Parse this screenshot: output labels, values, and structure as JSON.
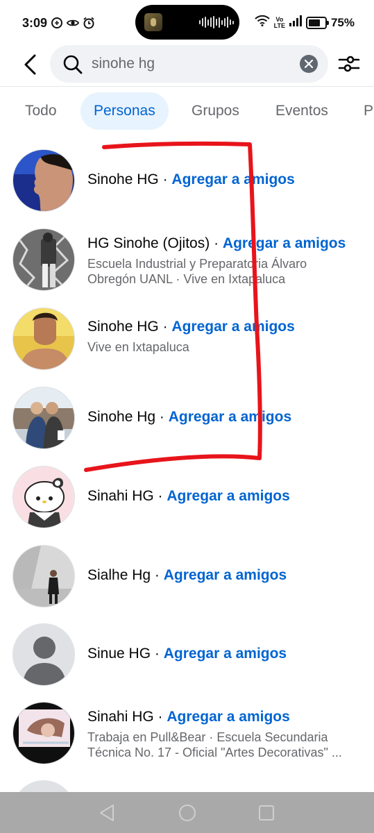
{
  "status_bar": {
    "time": "3:09",
    "volte": "Vo LTE",
    "battery": "75%"
  },
  "search": {
    "query": "sinohe hg"
  },
  "tabs": [
    {
      "label": "Todo",
      "active": false
    },
    {
      "label": "Personas",
      "active": true
    },
    {
      "label": "Grupos",
      "active": false
    },
    {
      "label": "Eventos",
      "active": false
    },
    {
      "label": "P",
      "active": false
    }
  ],
  "results": [
    {
      "name": "Sinohe HG",
      "action": "Agregar a amigos",
      "subtitle": ""
    },
    {
      "name": "HG Sinohe (Ojitos)",
      "action": "Agregar a amigos",
      "subtitle": "Escuela Industrial y Preparatoria Álvaro",
      "subtitle2": "Obregón UANL · Vive en Ixtapaluca"
    },
    {
      "name": "Sinohe HG",
      "action": "Agregar a amigos",
      "subtitle": "Vive en Ixtapaluca"
    },
    {
      "name": "Sinohe Hg",
      "action": "Agregar a amigos",
      "subtitle": ""
    },
    {
      "name": "Sinahi HG",
      "action": "Agregar a amigos",
      "subtitle": ""
    },
    {
      "name": "Sialhe Hg",
      "action": "Agregar a amigos",
      "subtitle": ""
    },
    {
      "name": "Sinue HG",
      "action": "Agregar a amigos",
      "subtitle": ""
    },
    {
      "name": "Sinahi HG",
      "action": "Agregar a amigos",
      "subtitle": "Trabaja en Pull&Bear · Escuela Secundaria",
      "subtitle2": "Técnica No. 17 - Oficial \"Artes Decorativas\" ..."
    }
  ],
  "colors": {
    "link": "#0064d1",
    "annotation": "#e8141b",
    "tab_active_bg": "#e7f3ff"
  },
  "icons": {
    "back": "back-arrow-icon",
    "search": "search-icon",
    "clear": "clear-icon",
    "filter": "filter-sliders-icon"
  }
}
